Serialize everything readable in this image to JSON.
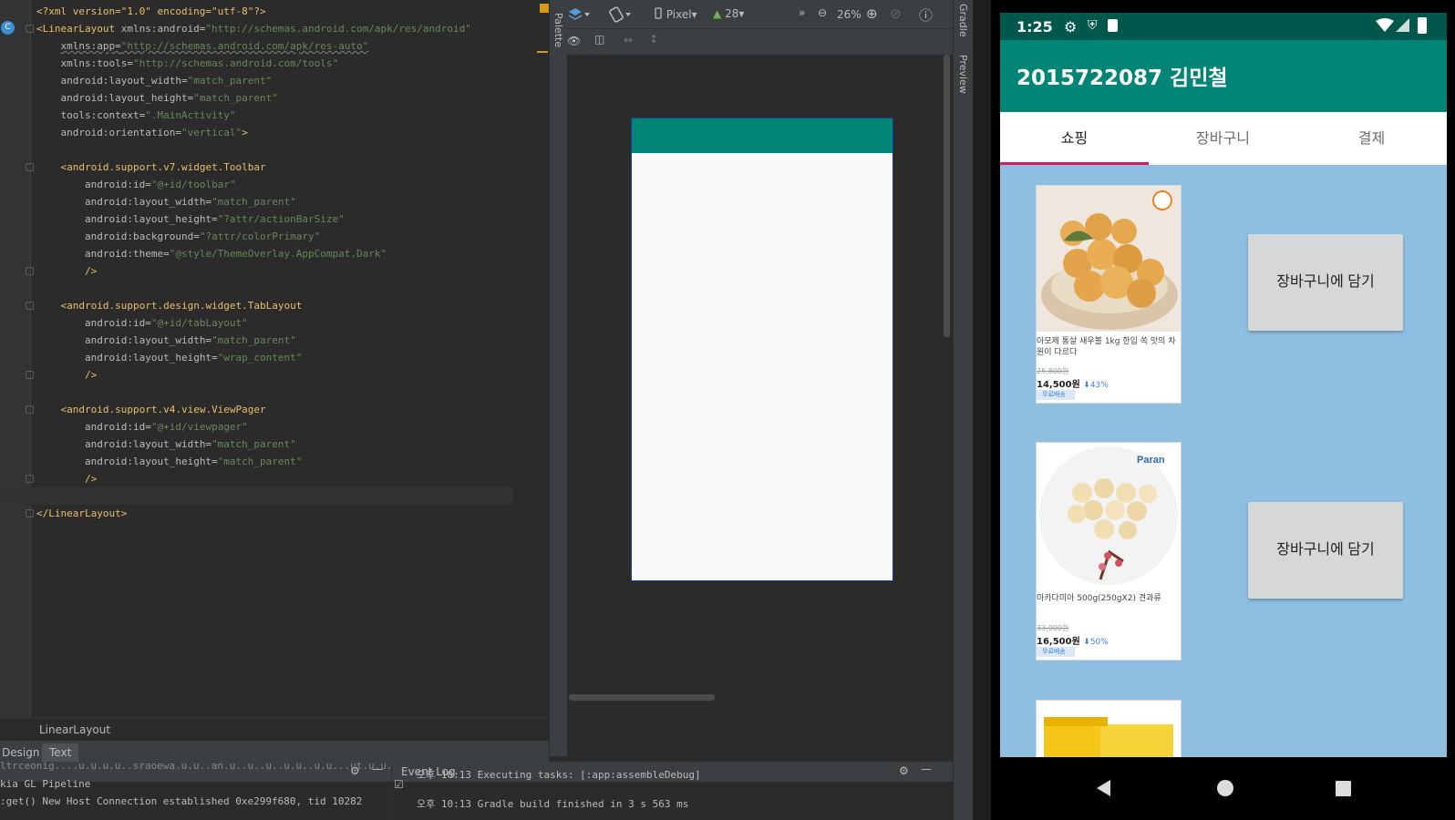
{
  "editor": {
    "lines": [
      {
        "type": "pi",
        "text": "<?xml version=\"1.0\" encoding=\"utf-8\"?>"
      },
      {
        "type": "open",
        "indent": 0,
        "tag": "<LinearLayout",
        "attr": " xmlns:android=",
        "val": "\"http://schemas.android.com/apk/res/android\""
      },
      {
        "type": "attr",
        "indent": 1,
        "attr": "xmlns:app=",
        "val": "\"http://schemas.android.com/apk/res-auto\"",
        "underline": true
      },
      {
        "type": "attr",
        "indent": 1,
        "attr": "xmlns:tools=",
        "val": "\"http://schemas.android.com/tools\""
      },
      {
        "type": "attr",
        "indent": 1,
        "attr": "android:layout_width=",
        "val": "\"match_parent\""
      },
      {
        "type": "attr",
        "indent": 1,
        "attr": "android:layout_height=",
        "val": "\"match_parent\""
      },
      {
        "type": "attr",
        "indent": 1,
        "attr": "tools:context=",
        "val": "\".MainActivity\""
      },
      {
        "type": "attr",
        "indent": 1,
        "attr": "android:orientation=",
        "val": "\"vertical\"",
        "tail": ">"
      },
      {
        "type": "blank"
      },
      {
        "type": "open",
        "indent": 1,
        "tag": "<android.support.v7.widget.Toolbar"
      },
      {
        "type": "attr",
        "indent": 2,
        "attr": "android:id=",
        "val": "\"@+id/toolbar\""
      },
      {
        "type": "attr",
        "indent": 2,
        "attr": "android:layout_width=",
        "val": "\"match_parent\""
      },
      {
        "type": "attr",
        "indent": 2,
        "attr": "android:layout_height=",
        "val": "\"?attr/actionBarSize\""
      },
      {
        "type": "attr",
        "indent": 2,
        "attr": "android:background=",
        "val": "\"?attr/colorPrimary\""
      },
      {
        "type": "attr",
        "indent": 2,
        "attr": "android:theme=",
        "val": "\"@style/ThemeOverlay.AppCompat.Dark\""
      },
      {
        "type": "close",
        "indent": 2,
        "tag": "/>"
      },
      {
        "type": "blank"
      },
      {
        "type": "open",
        "indent": 1,
        "tag": "<android.support.design.widget.TabLayout"
      },
      {
        "type": "attr",
        "indent": 2,
        "attr": "android:id=",
        "val": "\"@+id/tabLayout\""
      },
      {
        "type": "attr",
        "indent": 2,
        "attr": "android:layout_width=",
        "val": "\"match_parent\""
      },
      {
        "type": "attr",
        "indent": 2,
        "attr": "android:layout_height=",
        "val": "\"wrap_content\""
      },
      {
        "type": "close",
        "indent": 2,
        "tag": "/>"
      },
      {
        "type": "blank"
      },
      {
        "type": "open",
        "indent": 1,
        "tag": "<android.support.v4.view.ViewPager"
      },
      {
        "type": "attr",
        "indent": 2,
        "attr": "android:id=",
        "val": "\"@+id/viewpager\""
      },
      {
        "type": "attr",
        "indent": 2,
        "attr": "android:layout_width=",
        "val": "\"match_parent\""
      },
      {
        "type": "attr",
        "indent": 2,
        "attr": "android:layout_height=",
        "val": "\"match_parent\""
      },
      {
        "type": "close",
        "indent": 2,
        "tag": "/>"
      },
      {
        "type": "blank",
        "current": true
      },
      {
        "type": "close",
        "indent": 0,
        "tag": "</LinearLayout>"
      }
    ],
    "gutter_icon": "C",
    "breadcrumb": "LinearLayout",
    "tabs": [
      "Design",
      "Text"
    ]
  },
  "design_strip": {
    "palette": "Palette"
  },
  "design_toolbar": {
    "device": "Pixel",
    "api": "28",
    "zoom": "26%"
  },
  "right_strip": {
    "gradle": "Gradle",
    "preview": "Preview"
  },
  "bottom_left": {
    "lines": [
      "ltrceonig....u.u.u.u..sraoewa.u.u..an.u..u..u..u.u..u.u...ut.u.u...",
      "kia GL Pipeline",
      ":get() New Host Connection established 0xe299f680, tid 10282"
    ]
  },
  "event_log": {
    "title": "Event Log",
    "entries": [
      "오후 10:13  Executing tasks: [:app:assembleDebug]",
      "오후 10:13  Gradle build finished in 3 s 563 ms"
    ]
  },
  "device": {
    "time": "1:25",
    "app_title": "2015722087 김민철",
    "tabs": [
      "쇼핑",
      "장바구니",
      "결제"
    ],
    "selected_tab": 0,
    "products": [
      {
        "name": "아모제 통살 새우볼 1kg 한입 쏙 맛의 차원이 다르다",
        "old_price": "25,800원",
        "price": "14,500원",
        "discount": "43%",
        "badge": "무료배송",
        "button": "장바구니에 담기"
      },
      {
        "name": "마카다미아 500g(250gX2) 견과류",
        "old_price": "33,000원",
        "price": "16,500원",
        "discount": "50%",
        "badge": "무료배송",
        "button": "장바구니에 담기"
      }
    ],
    "colors": {
      "primary": "#008577",
      "primary_dark": "#00574b",
      "accent": "#d81b60",
      "background": "#8fbfe0"
    }
  }
}
